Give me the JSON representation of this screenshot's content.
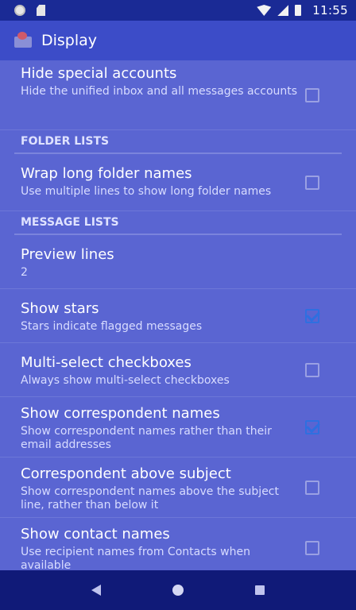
{
  "status_bar": {
    "time": "11:55"
  },
  "app_bar": {
    "title": "Display"
  },
  "prefs_top": [
    {
      "title": "Hide special accounts",
      "summary": "Hide the unified inbox and all messages accounts",
      "checked": false
    }
  ],
  "sections": {
    "folder_lists": "FOLDER LISTS",
    "message_lists": "MESSAGE LISTS"
  },
  "folder_prefs": [
    {
      "title": "Wrap long folder names",
      "summary": "Use multiple lines to show long folder names",
      "checked": false
    }
  ],
  "message_prefs": [
    {
      "title": "Preview lines",
      "summary": "2"
    },
    {
      "title": "Show stars",
      "summary": "Stars indicate flagged messages",
      "checked": true
    },
    {
      "title": "Multi-select checkboxes",
      "summary": "Always show multi-select checkboxes",
      "checked": false
    },
    {
      "title": "Show correspondent names",
      "summary": "Show correspondent names rather than their email addresses",
      "checked": true
    },
    {
      "title": "Correspondent above subject",
      "summary": "Show correspondent names above the subject line, rather than below it",
      "checked": false
    },
    {
      "title": "Show contact names",
      "summary": "Use recipient names from Contacts when available",
      "checked": false
    }
  ]
}
